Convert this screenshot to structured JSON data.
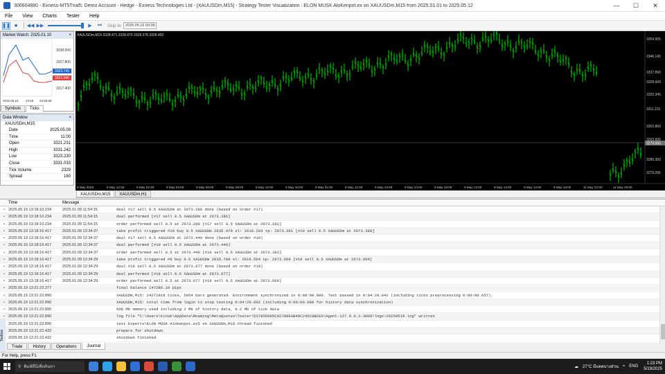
{
  "window": {
    "title": "306604880 - Exness-MT5Trial5: Demo Account - Hedge - Exness Technologies Ltd - [XAUUSDm,M15] - Strategy Tester Visualization : ELON MUSK AloKenpot.ex on XAUUSDm,M15 from 2025.01.01 to 2025.05.12"
  },
  "menu": [
    "File",
    "View",
    "Charts",
    "Tester",
    "Help"
  ],
  "toolbar": {
    "skip_label": "Skip to",
    "date_value": "2025.05.16 00:00"
  },
  "market_watch": {
    "title": "Market Watch: 2025.01.10",
    "prices": [
      "3338.000",
      "3327.800",
      "3323.745",
      "3317.400"
    ],
    "ask_tag": "3323.745",
    "bid_tag": "3321.040",
    "x_labels": [
      "2025.05.15",
      "23:59",
      "23:59:59"
    ],
    "tabs": [
      "Symbols",
      "Ticks"
    ]
  },
  "data_window": {
    "title": "Data Window",
    "symbol": "XAUUSDm,M15",
    "rows": [
      [
        "Date",
        "2025.05.09"
      ],
      [
        "Time",
        "11:00"
      ],
      [
        "Open",
        "3321.231"
      ],
      [
        "High",
        "3331.242"
      ],
      [
        "Low",
        "3323.230"
      ],
      [
        "Close",
        "3331.033"
      ],
      [
        "Tick Volume",
        "2329"
      ],
      [
        "Spread",
        "160"
      ]
    ]
  },
  "chart": {
    "header": "XAUUSDm,M15  3328.471 3328.870 3328.378 3328.459",
    "price_labels": [
      "3354.905",
      "3346.145",
      "3337.890",
      "3328.600",
      "3320.345",
      "3311.115",
      "3302.860",
      "3293.605",
      "3285.350",
      "3276.095"
    ],
    "current_price": "3279.565",
    "time_labels": [
      "9 May 2025",
      "9 May 12:30",
      "9 May 02:30",
      "9 May 03:00",
      "9 May 06:00",
      "9 May 09:00",
      "9 May 10:00",
      "9 May 18:00",
      "9 May 02:00",
      "9 May 12:00",
      "9 May 13:00",
      "9 May 14:00",
      "9 May 18:00",
      "9 May 12:00",
      "9 May 13:00",
      "9 May 14:00",
      "9 May 18:00",
      "11 May 22:00",
      "11 May 23:00"
    ]
  },
  "chart_tabs": [
    "XAUUSDm,M15",
    "XAUUSDm,H1"
  ],
  "log": {
    "col_time": "Time",
    "col_message": "Message",
    "rows": [
      [
        "2025.05.19 13:18:10.234",
        "2025.01.09 11:54:15",
        "deal #17 sell 0.5 XAUUSDm at 2673.286 done (based on order #17)"
      ],
      [
        "2025.05.19 13:18:10.234",
        "2025.01.09 11:54:15",
        "deal performed [#17 sell 0.5 XAUUSDm at 2673.286]"
      ],
      [
        "2025.05.19 13:18:10.234",
        "2025.01.09 11:54:15",
        "order performed sell 0.5 at 2673.286 [#17 sell 0.5 XAUUSDm at 2673.281]"
      ],
      [
        "2025.05.19 13:18:16.417",
        "2025.01.09 12:34:37",
        "take profit triggered #10 buy 0.5 XAUUSDm 2635.470 sl: 2616.203 tp: 2673.381 [#10 sell 0.5 XAUUSDm at 2673.380]"
      ],
      [
        "2025.05.19 13:18:16.417",
        "2025.01.09 12:34:37",
        "deal #17 sell 0.5 XAUUSDm at 2673.440 done (based on order #10)"
      ],
      [
        "2025.05.19 13:18:16.417",
        "2025.01.09 12:34:37",
        "deal performed [#10 sell 0.5 XAUUSDm at 2673.440]"
      ],
      [
        "2025.05.19 13:18:16.417",
        "2025.01.09 12:34:37",
        "order performed sell 0.5 at 2673.440 [#10 sell 0.5 XAUUSDm at 2673.381]"
      ],
      [
        "2025.05.19 13:18:16.417",
        "2025.01.09 12:34:29",
        "take profit triggered #9 buy 0.5 XAUUSDm 2635.789 sl: 2616.564 tp: 2673.669 [#19 sell 0.5 XAUUSDm at 2673.669]"
      ],
      [
        "2025.05.19 13:18:16.417",
        "2025.01.09 12:34:29",
        "deal #19 sell 0.5 XAUUSDm at 2673.677 done (based on order #19)"
      ],
      [
        "2025.05.19 13:18:16.417",
        "2025.01.09 12:34:29",
        "deal performed [#19 sell 0.5 XAUUSDm at 2673.677]"
      ],
      [
        "2025.05.19 13:18:16.417",
        "2025.01.09 12:34:29",
        "order performed sell 0.5 at 2673.677 [#19 sell 0.5 XAUUSDm at 2673.669]"
      ],
      [
        "2025.05.19 13:21:22.377",
        "",
        "final balance 147286.10 pips"
      ],
      [
        "2025.05.19 13:21:22.890",
        "",
        "XAUUSDm,M15: 24271919 ticks, 5954 bars generated. Environment synchronized in 0:00:00.080. Test passed in 0:04:28.042 (including ticks preprocessing 0:00:00.657)."
      ],
      [
        "2025.05.19 13:21:22.890",
        "",
        "XAUUSDm,M15: total time from login to stop testing 0:04:29.002 (including 0:00:00.080 for history data synchronization)"
      ],
      [
        "2025.05.19 13:21:22.890",
        "",
        "608 Mb memory used including 2 Mb of history data, 9.2 Mb of tick data"
      ],
      [
        "2025.05.19 13:21:22.890",
        "",
        "log file \"C:\\Users\\kinak\\AppData\\Roaming\\MetaQuotes\\Tester\\53785D095C92788EAB49C245C8BCE6\\Agent-127.0.0.1-3000\\logs\\20250519.log\" written"
      ],
      [
        "2025.05.19 13:21:22.890",
        "",
        "test Experts\\ELON MUSK AloKenpot.ex5 on XAUUSDm,M15 thread finished"
      ],
      [
        "2025.05.19 13:21:22.432",
        "",
        "prepare for shutdown"
      ],
      [
        "2025.05.19 13:21:22.432",
        "",
        "shutdown finished"
      ]
    ]
  },
  "toolbox_label": "Toolbox",
  "bottom_tabs": [
    "Trade",
    "History",
    "Operations",
    "Journal"
  ],
  "status": "For Help, press F1",
  "taskbar": {
    "search": "พิมพ์ที่นี่เพื่อค้นหา",
    "weather": "27°C มีแดดบางส่วน",
    "lang": "ENG",
    "time": "1:23 PM",
    "date": "5/19/2025"
  },
  "colors": {
    "candle": "#00e000",
    "chart_bg": "#000000",
    "mw_ask": "#1e64d2",
    "mw_bid": "#e03c3c"
  }
}
